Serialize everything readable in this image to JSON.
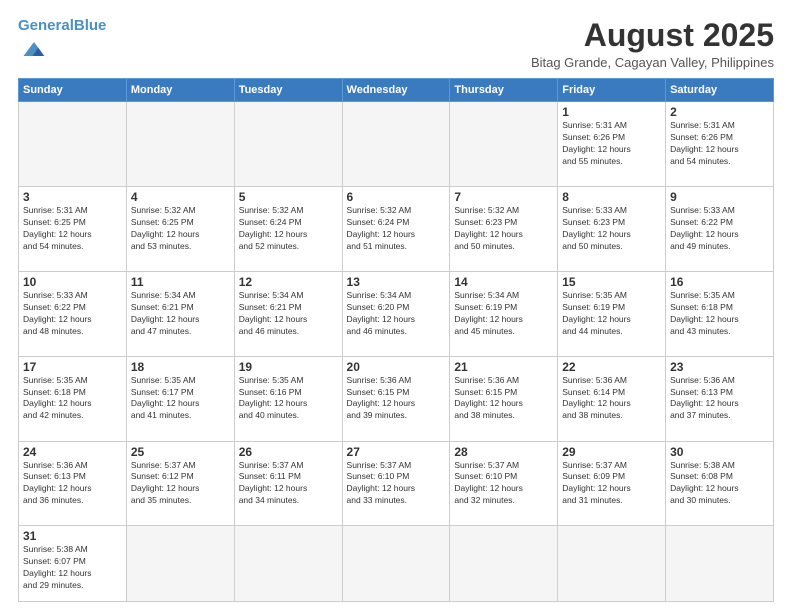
{
  "header": {
    "logo_general": "General",
    "logo_blue": "Blue",
    "month_year": "August 2025",
    "location": "Bitag Grande, Cagayan Valley, Philippines"
  },
  "days_of_week": [
    "Sunday",
    "Monday",
    "Tuesday",
    "Wednesday",
    "Thursday",
    "Friday",
    "Saturday"
  ],
  "weeks": [
    [
      {
        "day": "",
        "info": ""
      },
      {
        "day": "",
        "info": ""
      },
      {
        "day": "",
        "info": ""
      },
      {
        "day": "",
        "info": ""
      },
      {
        "day": "",
        "info": ""
      },
      {
        "day": "1",
        "info": "Sunrise: 5:31 AM\nSunset: 6:26 PM\nDaylight: 12 hours\nand 55 minutes."
      },
      {
        "day": "2",
        "info": "Sunrise: 5:31 AM\nSunset: 6:26 PM\nDaylight: 12 hours\nand 54 minutes."
      }
    ],
    [
      {
        "day": "3",
        "info": "Sunrise: 5:31 AM\nSunset: 6:25 PM\nDaylight: 12 hours\nand 54 minutes."
      },
      {
        "day": "4",
        "info": "Sunrise: 5:32 AM\nSunset: 6:25 PM\nDaylight: 12 hours\nand 53 minutes."
      },
      {
        "day": "5",
        "info": "Sunrise: 5:32 AM\nSunset: 6:24 PM\nDaylight: 12 hours\nand 52 minutes."
      },
      {
        "day": "6",
        "info": "Sunrise: 5:32 AM\nSunset: 6:24 PM\nDaylight: 12 hours\nand 51 minutes."
      },
      {
        "day": "7",
        "info": "Sunrise: 5:32 AM\nSunset: 6:23 PM\nDaylight: 12 hours\nand 50 minutes."
      },
      {
        "day": "8",
        "info": "Sunrise: 5:33 AM\nSunset: 6:23 PM\nDaylight: 12 hours\nand 50 minutes."
      },
      {
        "day": "9",
        "info": "Sunrise: 5:33 AM\nSunset: 6:22 PM\nDaylight: 12 hours\nand 49 minutes."
      }
    ],
    [
      {
        "day": "10",
        "info": "Sunrise: 5:33 AM\nSunset: 6:22 PM\nDaylight: 12 hours\nand 48 minutes."
      },
      {
        "day": "11",
        "info": "Sunrise: 5:34 AM\nSunset: 6:21 PM\nDaylight: 12 hours\nand 47 minutes."
      },
      {
        "day": "12",
        "info": "Sunrise: 5:34 AM\nSunset: 6:21 PM\nDaylight: 12 hours\nand 46 minutes."
      },
      {
        "day": "13",
        "info": "Sunrise: 5:34 AM\nSunset: 6:20 PM\nDaylight: 12 hours\nand 46 minutes."
      },
      {
        "day": "14",
        "info": "Sunrise: 5:34 AM\nSunset: 6:19 PM\nDaylight: 12 hours\nand 45 minutes."
      },
      {
        "day": "15",
        "info": "Sunrise: 5:35 AM\nSunset: 6:19 PM\nDaylight: 12 hours\nand 44 minutes."
      },
      {
        "day": "16",
        "info": "Sunrise: 5:35 AM\nSunset: 6:18 PM\nDaylight: 12 hours\nand 43 minutes."
      }
    ],
    [
      {
        "day": "17",
        "info": "Sunrise: 5:35 AM\nSunset: 6:18 PM\nDaylight: 12 hours\nand 42 minutes."
      },
      {
        "day": "18",
        "info": "Sunrise: 5:35 AM\nSunset: 6:17 PM\nDaylight: 12 hours\nand 41 minutes."
      },
      {
        "day": "19",
        "info": "Sunrise: 5:35 AM\nSunset: 6:16 PM\nDaylight: 12 hours\nand 40 minutes."
      },
      {
        "day": "20",
        "info": "Sunrise: 5:36 AM\nSunset: 6:15 PM\nDaylight: 12 hours\nand 39 minutes."
      },
      {
        "day": "21",
        "info": "Sunrise: 5:36 AM\nSunset: 6:15 PM\nDaylight: 12 hours\nand 38 minutes."
      },
      {
        "day": "22",
        "info": "Sunrise: 5:36 AM\nSunset: 6:14 PM\nDaylight: 12 hours\nand 38 minutes."
      },
      {
        "day": "23",
        "info": "Sunrise: 5:36 AM\nSunset: 6:13 PM\nDaylight: 12 hours\nand 37 minutes."
      }
    ],
    [
      {
        "day": "24",
        "info": "Sunrise: 5:36 AM\nSunset: 6:13 PM\nDaylight: 12 hours\nand 36 minutes."
      },
      {
        "day": "25",
        "info": "Sunrise: 5:37 AM\nSunset: 6:12 PM\nDaylight: 12 hours\nand 35 minutes."
      },
      {
        "day": "26",
        "info": "Sunrise: 5:37 AM\nSunset: 6:11 PM\nDaylight: 12 hours\nand 34 minutes."
      },
      {
        "day": "27",
        "info": "Sunrise: 5:37 AM\nSunset: 6:10 PM\nDaylight: 12 hours\nand 33 minutes."
      },
      {
        "day": "28",
        "info": "Sunrise: 5:37 AM\nSunset: 6:10 PM\nDaylight: 12 hours\nand 32 minutes."
      },
      {
        "day": "29",
        "info": "Sunrise: 5:37 AM\nSunset: 6:09 PM\nDaylight: 12 hours\nand 31 minutes."
      },
      {
        "day": "30",
        "info": "Sunrise: 5:38 AM\nSunset: 6:08 PM\nDaylight: 12 hours\nand 30 minutes."
      }
    ],
    [
      {
        "day": "31",
        "info": "Sunrise: 5:38 AM\nSunset: 6:07 PM\nDaylight: 12 hours\nand 29 minutes."
      },
      {
        "day": "",
        "info": ""
      },
      {
        "day": "",
        "info": ""
      },
      {
        "day": "",
        "info": ""
      },
      {
        "day": "",
        "info": ""
      },
      {
        "day": "",
        "info": ""
      },
      {
        "day": "",
        "info": ""
      }
    ]
  ]
}
